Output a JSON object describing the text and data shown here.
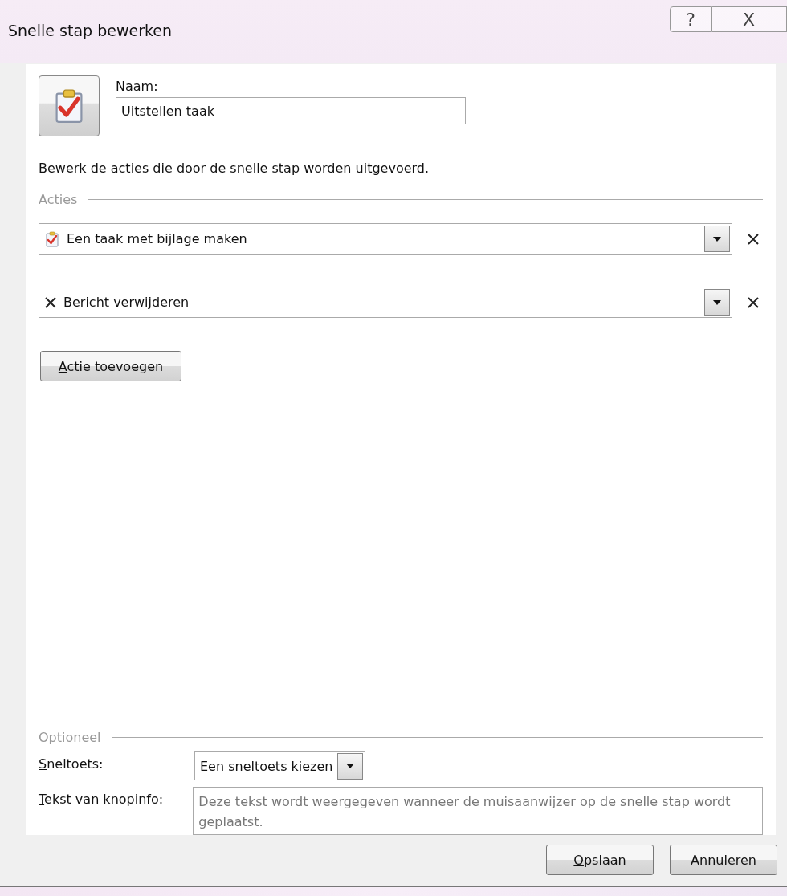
{
  "window": {
    "title": "Snelle stap bewerken",
    "help": "?",
    "close": "X"
  },
  "name_field": {
    "label": "Naam:",
    "underline_first": true,
    "value": "Uitstellen taak"
  },
  "instruction": "Bewerk de acties die door de snelle stap worden uitgevoerd.",
  "actions_group": {
    "title": "Acties"
  },
  "actions": [
    {
      "kind": "task",
      "label": "Een taak met bijlage maken"
    },
    {
      "kind": "delete",
      "label": "Bericht verwijderen"
    }
  ],
  "add_action_button": {
    "label": "Actie toevoegen",
    "underline_first": true
  },
  "optional_group": {
    "title": "Optioneel"
  },
  "shortcut": {
    "label": "Sneltoets:",
    "underline_first": true,
    "value": "Een sneltoets kiezen"
  },
  "tooltip": {
    "label": "Tekst van knopinfo:",
    "underline_first": true,
    "placeholder": "Deze tekst wordt weergegeven wanneer de muisaanwijzer op de snelle stap wordt geplaatst."
  },
  "buttons": [
    {
      "label": "Opslaan",
      "underline_first": true
    },
    {
      "label": "Annuleren",
      "underline_first": false
    }
  ]
}
